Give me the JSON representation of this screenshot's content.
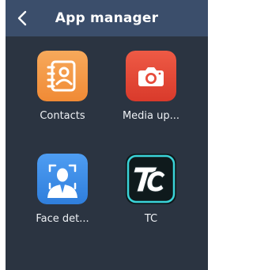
{
  "header": {
    "title": "App manager",
    "back_icon": "chevron-left-icon"
  },
  "apps": [
    {
      "label": "Contacts",
      "icon": "address-book-icon",
      "color": "#f49b4a"
    },
    {
      "label": "Media up...",
      "icon": "camera-icon",
      "color": "#e74c3c"
    },
    {
      "label": "Face det...",
      "icon": "face-scan-icon",
      "color": "#3f8ee8"
    },
    {
      "label": "TC",
      "icon": "tc-logo-icon",
      "color": "#0f2a2e"
    }
  ],
  "colors": {
    "background": "#2b3441",
    "topbar": "#3b4e6b",
    "text": "#ffffff"
  }
}
